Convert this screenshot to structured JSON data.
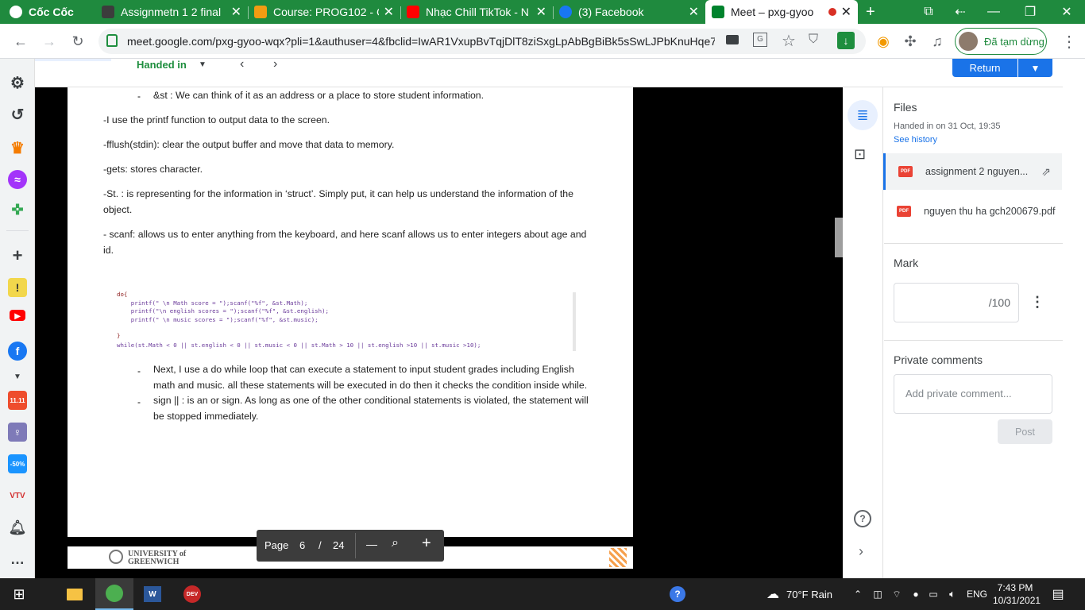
{
  "tabs": [
    {
      "title": "Cốc Cốc",
      "favicon_color": "#ffffff"
    },
    {
      "title": "Assignmetn 1 2 final",
      "favicon_color": "#444444"
    },
    {
      "title": "Course: PROG102 - G",
      "favicon_color": "#f39c12"
    },
    {
      "title": "Nhạc Chill TikTok - N",
      "favicon_color": "#ff0000"
    },
    {
      "title": "(3) Facebook",
      "favicon_color": "#1877f2"
    },
    {
      "title": "Meet – pxg-gyoo",
      "favicon_color": "#00832d"
    }
  ],
  "address": {
    "url": "meet.google.com/pxg-gyoo-wqx?pli=1&authuser=4&fbclid=IwAR1VxupBvTqjDlT8ziSxgLpAbBgBiBk5sSwLJPbKnuHqe7...",
    "profile_status": "Đã tạm dừng"
  },
  "classroom": {
    "status_label": "Handed in",
    "return_label": "Return"
  },
  "document": {
    "lines": [
      "&st : We can think of it as an address or a place to store student information.",
      "-I use the printf function to output data to the screen.",
      "-fflush(stdin): clear the output buffer and move that data to memory.",
      "-gets: stores character.",
      "-St. : is representing for the information in ‘struct’. Simply put, it can help us understand the information of the",
      "object.",
      "- scanf: allows us to enter anything from the keyboard, and here scanf allows us to enter integers about age and",
      "id."
    ],
    "code": [
      "do{",
      "    printf(\" \\n Math score = \");scanf(\"%f\", &st.Math);",
      "    printf(\"\\n english scores = \");scanf(\"%f\", &st.english);",
      "    printf(\" \\n music scores = \");scanf(\"%f\", &st.music);",
      "}",
      "while(st.Math < 0 || st.english < 0 || st.music < 0 || st.Math > 10 || st.english >10 || st.music >10);"
    ],
    "bullets": [
      "Next, I use a do while loop that can execute a statement to input student grades including English",
      "math and music. all these statements will be executed in do then it checks the condition inside while.",
      "sign || : is an or sign. As long as one of the other conditional statements is violated, the statement will",
      "be stopped immediately."
    ],
    "footer_logo_line1": "UNIVERSITY of",
    "footer_logo_line2": "GREENWICH"
  },
  "pager": {
    "label": "Page",
    "current": "6",
    "separator": "/",
    "total": "24"
  },
  "panel": {
    "files_heading": "Files",
    "handed_in_info": "Handed in on 31 Oct, 19:35",
    "see_history": "See history",
    "files": [
      "assignment 2 nguyen...",
      "nguyen thu ha gch200679.pdf"
    ],
    "mark_heading": "Mark",
    "mark_value": "/100",
    "private_heading": "Private comments",
    "comment_placeholder": "Add private comment...",
    "post_label": "Post"
  },
  "taskbar": {
    "weather": "70°F  Rain",
    "language": "ENG",
    "time": "7:43 PM",
    "date": "10/31/2021"
  },
  "colors": {
    "browser_accent": "#1f8a3e",
    "classroom_blue": "#1a73e8",
    "pdf_red": "#ea4335"
  }
}
